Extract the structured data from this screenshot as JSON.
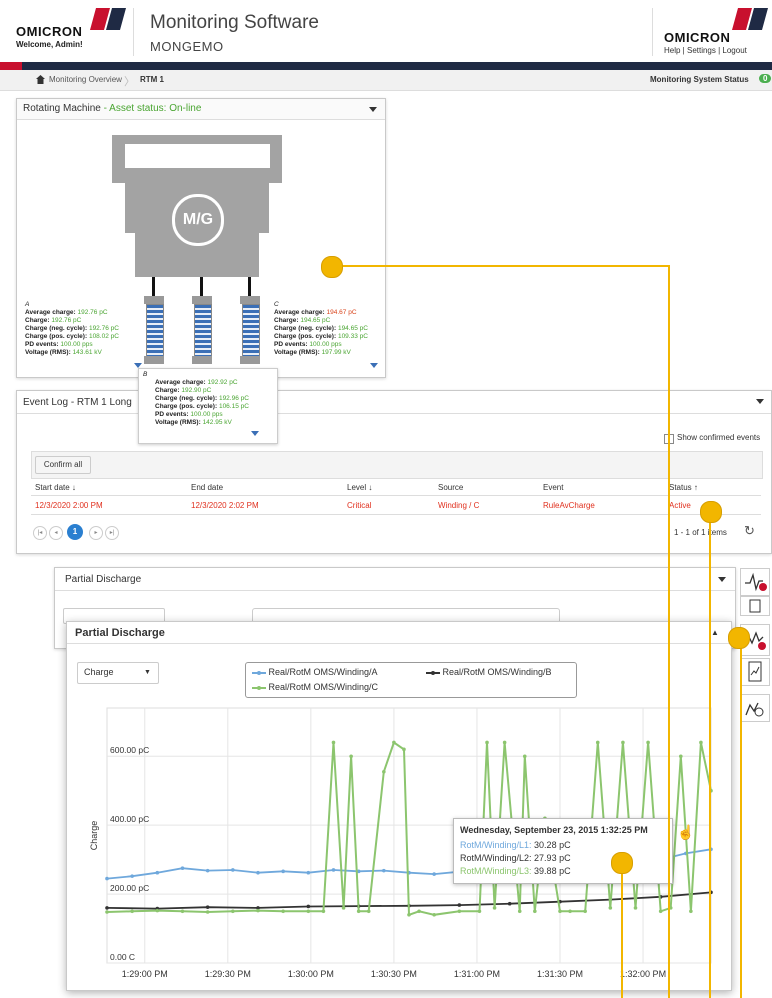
{
  "header": {
    "brand": "OMICRON",
    "welcome": "Welcome, Admin!",
    "app_title": "Monitoring Software",
    "app_subtitle": "MONGEMO",
    "brand_right": "OMICRON",
    "links": "Help | Settings | Logout"
  },
  "breadcrumb": {
    "home": "Monitoring Overview",
    "current": "RTM 1",
    "status_label": "Monitoring System Status",
    "status_count": "0"
  },
  "machine_panel": {
    "title": "Rotating Machine",
    "asset_status": "- Asset status: On-line",
    "machine_label": "M/G",
    "phase_a": {
      "label": "A",
      "avg_label": "Average charge:",
      "avg": "192.76 pC",
      "charge_label": "Charge:",
      "charge": "192.76 pC",
      "neg_label": "Charge (neg. cycle):",
      "neg": "192.76 pC",
      "pos_label": "Charge (pos. cycle):",
      "pos": "108.02 pC",
      "pd_label": "PD events:",
      "pd": "100.00 pps",
      "volt_label": "Voltage (RMS):",
      "volt": "143.61 kV"
    },
    "phase_b": {
      "label": "B",
      "avg_label": "Average charge:",
      "avg": "192.92 pC",
      "charge_label": "Charge:",
      "charge": "192.90 pC",
      "neg_label": "Charge (neg. cycle):",
      "neg": "192.96 pC",
      "pos_label": "Charge (pos. cycle):",
      "pos": "106.15 pC",
      "pd_label": "PD events:",
      "pd": "100.00 pps",
      "volt_label": "Voltage (RMS):",
      "volt": "142.95 kV"
    },
    "phase_c": {
      "label": "C",
      "avg_label": "Average charge:",
      "avg": "194.67 pC",
      "charge_label": "Charge:",
      "charge": "194.65 pC",
      "neg_label": "Charge (neg. cycle):",
      "neg": "194.65 pC",
      "pos_label": "Charge (pos. cycle):",
      "pos": "109.33 pC",
      "pd_label": "PD events:",
      "pd": "100.00 pps",
      "volt_label": "Voltage (RMS):",
      "volt": "197.99 kV"
    }
  },
  "event_log": {
    "title": "Event Log - RTM 1 Long",
    "show_confirmed": "Show confirmed events",
    "confirm_all": "Confirm all",
    "columns": [
      "Start date",
      "End date",
      "Level",
      "Source",
      "Event",
      "Status"
    ],
    "row": [
      "12/3/2020 2:00 PM",
      "12/3/2020 2:02 PM",
      "Critical",
      "Winding / C",
      "RuleAvCharge",
      "Active"
    ],
    "page": "1",
    "items_info": "1 - 1 of 1 items"
  },
  "pd_panel_back": {
    "title": "Partial Discharge"
  },
  "pd_panel": {
    "title": "Partial Discharge",
    "dropdown": "Charge",
    "legend": [
      "Real/RotM OMS/Winding/A",
      "Real/RotM OMS/Winding/B",
      "Real/RotM OMS/Winding/C"
    ],
    "tooltip": {
      "date": "Wednesday, September 23, 2015 1:32:25 PM",
      "l1_label": "RotM/Winding/L1:",
      "l1": "30.28 pC",
      "l2_label": "RotM/Winding/L2:",
      "l2": "27.93 pC",
      "l3_label": "RotM/Winding/L3:",
      "l3": "39.88 pC"
    }
  },
  "chart_data": {
    "type": "line",
    "ylabel": "Charge",
    "y_ticks": [
      "0.00 C",
      "200.00 pC",
      "400.00 pC",
      "600.00 pC"
    ],
    "x_ticks": [
      "1:29:00 PM",
      "1:29:30 PM",
      "1:30:00 PM",
      "1:30:30 PM",
      "1:31:00 PM",
      "1:31:30 PM",
      "1:32:00 PM"
    ],
    "ylim": [
      0,
      740
    ],
    "xlim": [
      0,
      240
    ],
    "grid": true,
    "series": [
      {
        "name": "Real/RotM OMS/Winding/A",
        "color": "#6fa8dc",
        "x": [
          0,
          10,
          20,
          30,
          40,
          50,
          60,
          70,
          80,
          90,
          100,
          110,
          120,
          130,
          140,
          150,
          160,
          170,
          180,
          190,
          200,
          210,
          220,
          230,
          240
        ],
        "values": [
          245,
          252,
          262,
          275,
          268,
          270,
          262,
          266,
          262,
          270,
          266,
          268,
          262,
          258,
          265,
          265,
          262,
          278,
          280,
          275,
          282,
          290,
          300,
          318,
          330
        ]
      },
      {
        "name": "Real/RotM OMS/Winding/B",
        "color": "#333333",
        "x": [
          0,
          20,
          40,
          60,
          80,
          100,
          120,
          140,
          160,
          180,
          200,
          220,
          240
        ],
        "values": [
          160,
          158,
          162,
          160,
          164,
          165,
          166,
          168,
          172,
          178,
          184,
          192,
          205
        ]
      },
      {
        "name": "Real/RotM OMS/Winding/C",
        "color": "#8cc56e",
        "x": [
          0,
          10,
          20,
          30,
          40,
          50,
          60,
          70,
          80,
          86,
          90,
          94,
          97,
          100,
          104,
          110,
          114,
          118,
          120,
          124,
          130,
          140,
          148,
          151,
          154,
          158,
          164,
          166,
          170,
          174,
          180,
          184,
          190,
          195,
          200,
          205,
          210,
          215,
          220,
          224,
          228,
          232,
          236,
          240
        ],
        "values": [
          148,
          150,
          152,
          150,
          148,
          150,
          152,
          150,
          150,
          150,
          640,
          160,
          600,
          150,
          150,
          555,
          640,
          620,
          140,
          150,
          140,
          150,
          150,
          640,
          160,
          640,
          150,
          600,
          150,
          420,
          150,
          150,
          150,
          640,
          160,
          640,
          160,
          640,
          150,
          160,
          600,
          150,
          640,
          500
        ]
      }
    ]
  },
  "colors": {
    "brand_red": "#c8102e",
    "dark_bar": "#1f2a44",
    "accent_yellow": "#f2b600",
    "critical_red": "#e0301e",
    "green_value": "#4aa532",
    "status_green": "#4caf50",
    "pager_blue": "#2a7fd0"
  }
}
